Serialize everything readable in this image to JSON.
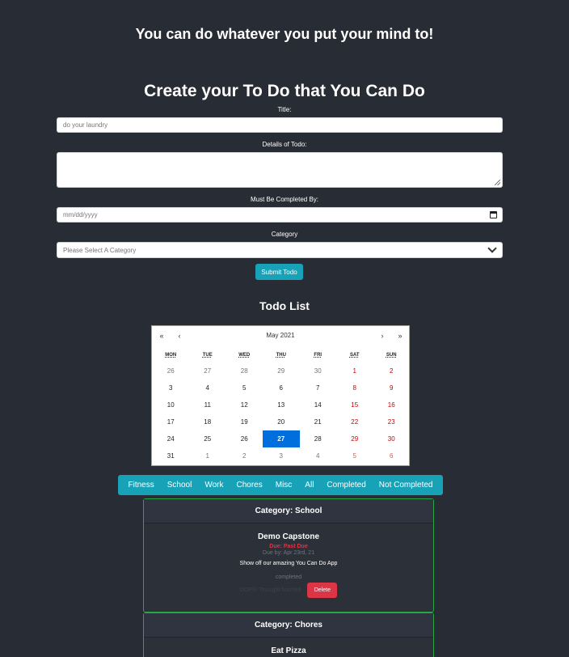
{
  "tagline": "You can do whatever you put your mind to!",
  "form": {
    "title": "Create your To Do that You Can Do",
    "title_label": "Title:",
    "title_placeholder": "do your laundry",
    "details_label": "Details of Todo:",
    "date_label": "Must Be Completed By:",
    "date_placeholder": "mm/dd/yyyy",
    "category_label": "Category",
    "category_selected": "Please Select A Category",
    "submit_label": "Submit Todo"
  },
  "todo_list": {
    "title": "Todo List"
  },
  "calendar": {
    "month_label": "May 2021",
    "nav": {
      "prev_year": "«",
      "prev_month": "‹",
      "next_month": "›",
      "next_year": "»"
    },
    "weekdays": [
      "MON",
      "TUE",
      "WED",
      "THU",
      "FRI",
      "SAT",
      "SUN"
    ],
    "weeks": [
      [
        "26",
        "27",
        "28",
        "29",
        "30",
        "1",
        "2"
      ],
      [
        "3",
        "4",
        "5",
        "6",
        "7",
        "8",
        "9"
      ],
      [
        "10",
        "11",
        "12",
        "13",
        "14",
        "15",
        "16"
      ],
      [
        "17",
        "18",
        "19",
        "20",
        "21",
        "22",
        "23"
      ],
      [
        "24",
        "25",
        "26",
        "27",
        "28",
        "29",
        "30"
      ],
      [
        "31",
        "1",
        "2",
        "3",
        "4",
        "5",
        "6"
      ]
    ],
    "selected_day": "27",
    "colors": {
      "selected": "#006edc",
      "weekend": "#d10000",
      "neighbor": "#757575"
    }
  },
  "filters": [
    "Fitness",
    "School",
    "Work",
    "Chores",
    "Misc",
    "All",
    "Completed",
    "Not Completed"
  ],
  "cards": [
    {
      "category_heading": "Category: School",
      "todo_title": "Demo Capstone",
      "due_status": "Due: Past Due",
      "due_by": "Due by: Apr 23rd, 21",
      "details": "Show off our amazing You Can Do App",
      "status": "completed",
      "finished_text": "OOPS! Thought finished",
      "delete_label": "Delete"
    },
    {
      "category_heading": "Category: Chores",
      "todo_title": "Eat Pizza"
    }
  ],
  "colors": {
    "background": "#282c34",
    "accent": "#17a2b8",
    "card_border": "#28a745",
    "danger": "#dc3545"
  }
}
